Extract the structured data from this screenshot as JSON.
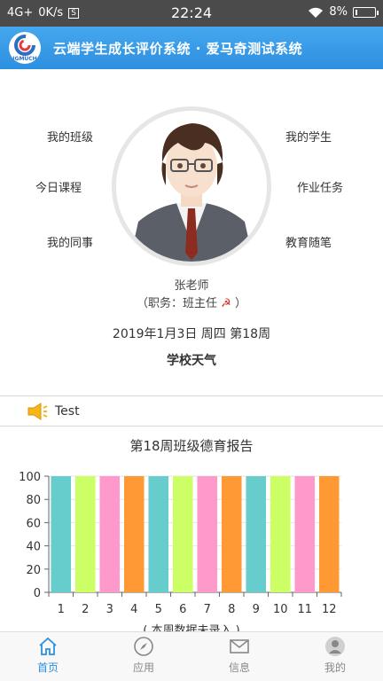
{
  "status_bar": {
    "network": "4G+",
    "speed": "0K/s",
    "s_badge": "S",
    "time": "22:24",
    "battery": "8%",
    "battery_level": 0.08
  },
  "header": {
    "logo_text": "IGMUCH",
    "title": "云端学生成长评价系统 · 爱马奇测试系统"
  },
  "menu": {
    "left": [
      "我的班级",
      "今日课程",
      "我的同事"
    ],
    "right": [
      "我的学生",
      "作业任务",
      "教育随笔"
    ]
  },
  "teacher": {
    "name": "张老师",
    "role_prefix": "（职务：班主任",
    "role_suffix": "）",
    "party_icon": "☭"
  },
  "date_line": "2019年1月3日 周四 第18周",
  "weather_label": "学校天气",
  "notice": {
    "text": "Test"
  },
  "chart_data": {
    "type": "bar",
    "title": "第18周班级德育报告",
    "categories": [
      "1",
      "2",
      "3",
      "4",
      "5",
      "6",
      "7",
      "8",
      "9",
      "10",
      "11",
      "12"
    ],
    "values": [
      100,
      100,
      100,
      100,
      100,
      100,
      100,
      100,
      100,
      100,
      100,
      100
    ],
    "colors": [
      "#66cccc",
      "#ccff66",
      "#ff99cc",
      "#ff9933",
      "#66cccc",
      "#ccff66",
      "#ff99cc",
      "#ff9933",
      "#66cccc",
      "#ccff66",
      "#ff99cc",
      "#ff9933"
    ],
    "ylim": [
      0,
      100
    ],
    "yticks": [
      0,
      20,
      40,
      60,
      80,
      100
    ],
    "grid": true,
    "note": "( 本周数据未录入 )"
  },
  "tabbar": {
    "items": [
      {
        "label": "首页",
        "icon": "home-icon",
        "active": true
      },
      {
        "label": "应用",
        "icon": "compass-icon",
        "active": false
      },
      {
        "label": "信息",
        "icon": "mail-icon",
        "active": false
      },
      {
        "label": "我的",
        "icon": "user-icon",
        "active": false
      }
    ]
  },
  "colors": {
    "accent": "#2d8fe0",
    "status_bar": "#4b4b4b"
  }
}
